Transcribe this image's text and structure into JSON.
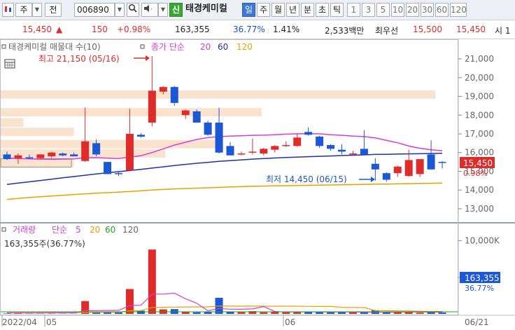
{
  "toolbar": {
    "market_label": "주",
    "quote_label": "전",
    "code_value": "006890",
    "sound_icon": "speaker-icon",
    "new_badge": "신",
    "stock_name": "태경케미컬",
    "periods": [
      "일",
      "주",
      "월",
      "년",
      "분",
      "초",
      "틱"
    ],
    "active_period": "일",
    "intervals": [
      "1",
      "3",
      "5",
      "10",
      "20",
      "30",
      "60",
      "120"
    ]
  },
  "quote": {
    "price": "15,450",
    "change": "150",
    "change_pct": "+0.98%",
    "volume": "163,355",
    "volume_ratio": "36.77%",
    "turnover": "1.41%",
    "amount": "2,533백만",
    "order_label": "최우선",
    "ask_price": "15,500",
    "bid_price": "15,450",
    "tail_label": "시 1"
  },
  "price_panel": {
    "legend_name": "태경케미컬 매물대 수(10)",
    "legend_ma_label": "종가 단순",
    "legend_ma": [
      "20",
      "60",
      "120"
    ],
    "high_annotation": "최고 21,150 (05/16)",
    "low_annotation": "최저 14,450 (06/15)",
    "current_price_tag": "15,450",
    "current_pct_tag": "0.98%",
    "calendar_icon": "calendar-icon"
  },
  "volume_panel": {
    "legend_name": "거래량",
    "legend_ma_label": "단순",
    "legend_ma": [
      "5",
      "20",
      "60",
      "120"
    ],
    "volume_text": "163,355주(36.77%)",
    "current_volume_tag": "163,355",
    "current_pct_tag": "36.77%"
  },
  "colors": {
    "up": "#e02b2b",
    "down": "#1b57d6",
    "ma5": "#d63cd6",
    "ma20": "#d63cd6",
    "ma60": "#1f2fb4",
    "ma120": "#e8a000",
    "volume_profile": "#f9e3cf"
  },
  "chart_data": {
    "type": "candlestick",
    "y_axis": {
      "min": 12400,
      "max": 21900,
      "ticks": [
        "21,000",
        "20,000",
        "19,000",
        "18,000",
        "17,000",
        "16,000",
        "15,000",
        "14,000",
        "13,000"
      ]
    },
    "x_labels": [
      "2022/04",
      "05",
      "06",
      "06/21"
    ],
    "candles": [
      {
        "o": 15900,
        "h": 16050,
        "l": 15600,
        "c": 15650
      },
      {
        "o": 15700,
        "h": 15950,
        "l": 15400,
        "c": 15850
      },
      {
        "o": 15750,
        "h": 15900,
        "l": 15650,
        "c": 15700
      },
      {
        "o": 15700,
        "h": 15900,
        "l": 15650,
        "c": 15900
      },
      {
        "o": 15800,
        "h": 16050,
        "l": 15700,
        "c": 16000
      },
      {
        "o": 15950,
        "h": 16000,
        "l": 15800,
        "c": 15850
      },
      {
        "o": 15900,
        "h": 16000,
        "l": 15800,
        "c": 15800
      },
      {
        "o": 15550,
        "h": 18400,
        "l": 15500,
        "c": 16600
      },
      {
        "o": 16500,
        "h": 16700,
        "l": 15800,
        "c": 15900
      },
      {
        "o": 15500,
        "h": 15500,
        "l": 14850,
        "c": 14850
      },
      {
        "o": 14900,
        "h": 15000,
        "l": 14750,
        "c": 14850
      },
      {
        "o": 15050,
        "h": 18350,
        "l": 15050,
        "c": 17000
      },
      {
        "o": 16950,
        "h": 17050,
        "l": 16800,
        "c": 16850
      },
      {
        "o": 17600,
        "h": 21150,
        "l": 17400,
        "c": 19300
      },
      {
        "o": 19250,
        "h": 19550,
        "l": 19100,
        "c": 19500
      },
      {
        "o": 19500,
        "h": 19550,
        "l": 18500,
        "c": 18650
      },
      {
        "o": 18000,
        "h": 18300,
        "l": 17800,
        "c": 18250
      },
      {
        "o": 18200,
        "h": 18300,
        "l": 17600,
        "c": 17600
      },
      {
        "o": 17600,
        "h": 17700,
        "l": 16900,
        "c": 16950
      },
      {
        "o": 17600,
        "h": 18400,
        "l": 15950,
        "c": 16000
      },
      {
        "o": 16350,
        "h": 16550,
        "l": 15850,
        "c": 15850
      },
      {
        "o": 15900,
        "h": 16050,
        "l": 15850,
        "c": 15950
      },
      {
        "o": 16000,
        "h": 16750,
        "l": 15900,
        "c": 16050
      },
      {
        "o": 15950,
        "h": 16250,
        "l": 15850,
        "c": 16200
      },
      {
        "o": 16150,
        "h": 16400,
        "l": 16000,
        "c": 16350
      },
      {
        "o": 16400,
        "h": 16600,
        "l": 16300,
        "c": 16400
      },
      {
        "o": 16350,
        "h": 17000,
        "l": 16300,
        "c": 16800
      },
      {
        "o": 17100,
        "h": 17350,
        "l": 16900,
        "c": 16950
      },
      {
        "o": 16850,
        "h": 16900,
        "l": 16250,
        "c": 16350
      },
      {
        "o": 16400,
        "h": 16450,
        "l": 16100,
        "c": 16200
      },
      {
        "o": 16150,
        "h": 16450,
        "l": 15900,
        "c": 16050
      },
      {
        "o": 15950,
        "h": 16100,
        "l": 15850,
        "c": 15950
      },
      {
        "o": 16200,
        "h": 17200,
        "l": 15850,
        "c": 15900
      },
      {
        "o": 15400,
        "h": 15700,
        "l": 14500,
        "c": 15100
      },
      {
        "o": 14900,
        "h": 14950,
        "l": 14450,
        "c": 14550
      },
      {
        "o": 14900,
        "h": 15300,
        "l": 14700,
        "c": 15250
      },
      {
        "o": 14750,
        "h": 16150,
        "l": 14700,
        "c": 15600
      },
      {
        "o": 14850,
        "h": 15600,
        "l": 14700,
        "c": 15650
      },
      {
        "o": 15900,
        "h": 16650,
        "l": 15100,
        "c": 15100
      },
      {
        "o": 15500,
        "h": 15550,
        "l": 15150,
        "c": 15450
      }
    ],
    "ma_20": [
      15700,
      15680,
      15660,
      15650,
      15640,
      15650,
      15660,
      15720,
      15730,
      15700,
      15680,
      15760,
      15830,
      16000,
      16200,
      16400,
      16550,
      16700,
      16800,
      16850,
      16880,
      16900,
      16920,
      16930,
      16950,
      16980,
      17000,
      17010,
      17000,
      16950,
      16920,
      16880,
      16850,
      16780,
      16650,
      16520,
      16350,
      16230,
      16150,
      16100
    ],
    "ma_60": [
      14300,
      14370,
      14440,
      14510,
      14580,
      14650,
      14720,
      14790,
      14860,
      14920,
      14980,
      15040,
      15100,
      15170,
      15240,
      15310,
      15370,
      15430,
      15480,
      15530,
      15570,
      15610,
      15650,
      15680,
      15710,
      15740,
      15760,
      15780,
      15800,
      15820,
      15840,
      15860,
      15880,
      15900,
      15910,
      15920,
      15930,
      15940,
      15950,
      15960
    ],
    "ma_120": [
      13500,
      13550,
      13600,
      13640,
      13680,
      13720,
      13760,
      13800,
      13830,
      13860,
      13890,
      13920,
      13960,
      14000,
      14030,
      14060,
      14080,
      14100,
      14120,
      14140,
      14160,
      14180,
      14200,
      14210,
      14220,
      14230,
      14240,
      14250,
      14260,
      14270,
      14280,
      14290,
      14300,
      14310,
      14320,
      14330,
      14340,
      14350,
      14360,
      14370
    ],
    "volume_profile": [
      {
        "price": 19100,
        "length": 0.95
      },
      {
        "price": 18150,
        "length": 0.57
      },
      {
        "price": 17600,
        "length": 0.05
      },
      {
        "price": 17100,
        "length": 0.16
      },
      {
        "price": 16450,
        "length": 0.47
      },
      {
        "price": 15950,
        "length": 0.36
      },
      {
        "price": 15450,
        "length": 0.16
      }
    ],
    "volume_y_max": 11500,
    "volume_ticks": [
      "10,000K",
      "5,000K"
    ],
    "volumes": [
      60,
      60,
      30,
      30,
      40,
      30,
      30,
      1750,
      160,
      230,
      200,
      3400,
      430,
      8800,
      620,
      650,
      330,
      220,
      310,
      2200,
      300,
      230,
      370,
      220,
      250,
      230,
      330,
      300,
      260,
      230,
      230,
      220,
      260,
      500,
      200,
      250,
      230,
      160,
      240,
      180
    ],
    "volume_ma_5": [
      120,
      120,
      120,
      120,
      140,
      140,
      140,
      440,
      450,
      470,
      480,
      1140,
      1180,
      2700,
      2700,
      2840,
      2070,
      1460,
      420,
      740,
      640,
      630,
      680,
      1000,
      330,
      260,
      270,
      270,
      270,
      260,
      270,
      250,
      230,
      250,
      230,
      240,
      260,
      260,
      250,
      230
    ],
    "volume_ma_20": [
      150,
      150,
      150,
      150,
      160,
      160,
      160,
      200,
      210,
      220,
      230,
      420,
      440,
      880,
      910,
      930,
      950,
      960,
      960,
      1070,
      1060,
      1050,
      1060,
      1050,
      1050,
      1050,
      1050,
      1030,
      1020,
      1020,
      900,
      880,
      870,
      450,
      430,
      410,
      400,
      350,
      340,
      330
    ]
  }
}
